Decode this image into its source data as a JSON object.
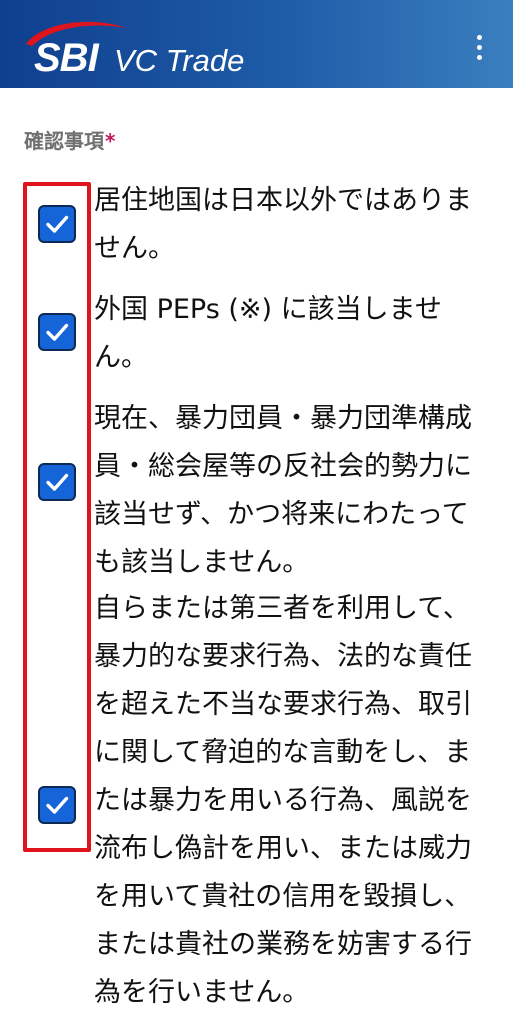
{
  "header": {
    "logo_text_sbi": "SBI",
    "logo_text_vc": "VC Trade",
    "menu_icon": "more-vertical-icon",
    "colors": {
      "gradient_start": "#0f3f8f",
      "gradient_end": "#3b7fbf",
      "swoosh": "#e0141c"
    }
  },
  "form": {
    "section_label": "確認事項",
    "required_mark": "*",
    "items": [
      {
        "text": "居住地国は日本以外ではありません。",
        "checked": true
      },
      {
        "text": "外国 PEPs (※) に該当しません。",
        "checked": true
      },
      {
        "text": "現在、暴力団員・暴力団準構成員・総会屋等の反社会的勢力に該当せず、かつ将来にわたっても該当しません。",
        "checked": true
      },
      {
        "text": "自らまたは第三者を利用して、暴力的な要求行為、法的な責任を超えた不当な要求行為、取引に関して脅迫的な言動をし、または暴力を用いる行為、風説を流布し偽計を用い、または威力を用いて貴社の信用を毀損し、または貴社の業務を妨害する行為を行いません。",
        "checked": true
      }
    ],
    "colors": {
      "checkbox": "#1565d8",
      "highlight": "#e0141c",
      "required": "#c2185b"
    }
  }
}
